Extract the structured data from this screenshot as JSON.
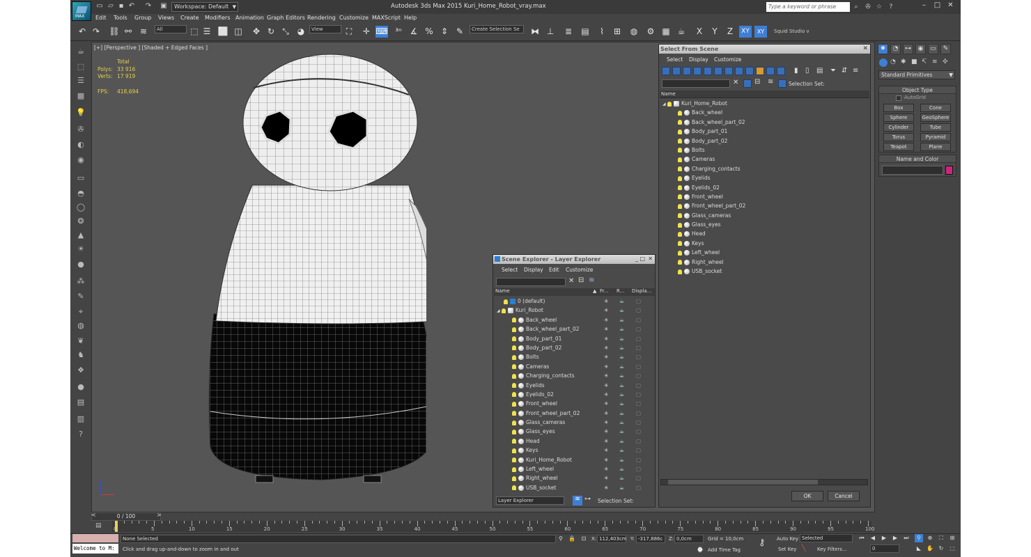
{
  "window": {
    "title": "Autodesk 3ds Max  2015    Kuri_Home_Robot_vray.max",
    "workspace": "Workspace: Default",
    "search_placeholder": "Type a keyword or phrase",
    "logo_text": "MAX"
  },
  "menu": [
    "Edit",
    "Tools",
    "Group",
    "Views",
    "Create",
    "Modifiers",
    "Animation",
    "Graph Editors",
    "Rendering",
    "Customize",
    "MAXScript",
    "Help"
  ],
  "toolbar": {
    "filter": "All",
    "refcoord": "View",
    "selection_set": "Create Selection Se",
    "axes": [
      "X",
      "Y",
      "Z",
      "XY",
      "XY"
    ],
    "studio": "Squid Studio v"
  },
  "viewport": {
    "label": "[+] [Perspective ] [Shaded + Edged Faces ]",
    "stats": {
      "total_label": "Total",
      "polys_label": "Polys:",
      "polys": "33 916",
      "verts_label": "Verts:",
      "verts": "17 919",
      "fps_label": "FPS:",
      "fps": "418,694"
    }
  },
  "select_from_scene": {
    "title": "Select From Scene",
    "menu": [
      "Select",
      "Display",
      "Customize"
    ],
    "selection_set_label": "Selection Set:",
    "col_name": "Name",
    "root": "Kuri_Home_Robot",
    "items": [
      "Back_wheel",
      "Back_wheel_part_02",
      "Body_part_01",
      "Body_part_02",
      "Bolts",
      "Cameras",
      "Charging_contacts",
      "Eyelids",
      "Eyelids_02",
      "Front_wheel",
      "Front_wheel_part_02",
      "Glass_cameras",
      "Glass_eyes",
      "Head",
      "Keys",
      "Left_wheel",
      "Right_wheel",
      "USB_socket"
    ],
    "ok": "OK",
    "cancel": "Cancel"
  },
  "scene_explorer": {
    "title": "Scene Explorer - Layer Explorer",
    "menu": [
      "Select",
      "Display",
      "Edit",
      "Customize"
    ],
    "columns": [
      "Name",
      "Fr...",
      "R...",
      "Displa..."
    ],
    "default_layer": "0 (default)",
    "layer": "Kuri_Robot",
    "items": [
      "Back_wheel",
      "Back_wheel_part_02",
      "Body_part_01",
      "Body_part_02",
      "Bolts",
      "Cameras",
      "Charging_contacts",
      "Eyelids",
      "Eyelids_02",
      "Front_wheel",
      "Front_wheel_part_02",
      "Glass_cameras",
      "Glass_eyes",
      "Head",
      "Keys",
      "Kuri_Home_Robot",
      "Left_wheel",
      "Right_wheel",
      "USB_socket"
    ],
    "footer_mode": "Layer Explorer",
    "footer_selset": "Selection Set:"
  },
  "command_panel": {
    "category": "Standard Primitives",
    "object_type": "Object Type",
    "autogrid": "AutoGrid",
    "buttons": [
      "Box",
      "Cone",
      "Sphere",
      "GeoSphere",
      "Cylinder",
      "Tube",
      "Torus",
      "Pyramid",
      "Teapot",
      "Plane"
    ],
    "name_color": "Name and Color",
    "color_swatch": "#c8287c"
  },
  "timeline": {
    "frame": "0 / 100",
    "ticks": [
      "0",
      "5",
      "10",
      "15",
      "20",
      "25",
      "30",
      "35",
      "40",
      "45",
      "50",
      "55",
      "60",
      "65",
      "70",
      "75",
      "80",
      "85",
      "90",
      "95",
      "100"
    ]
  },
  "status": {
    "selected": "None Selected",
    "prompt": "Click and drag up-and-down to zoom in and out",
    "maxscript": "Welcome to M:",
    "x_label": "X:",
    "x": "112,403cm",
    "y_label": "Y:",
    "y": "-317,886c",
    "z_label": "Z:",
    "z": "0,0cm",
    "grid": "Grid = 10,0cm",
    "autokey": "Auto Key",
    "setkey": "Set Key",
    "selected_dd": "Selected",
    "keyfilters": "Key Filters...",
    "add_time_tag": "Add Time Tag",
    "frame_field": "0"
  }
}
